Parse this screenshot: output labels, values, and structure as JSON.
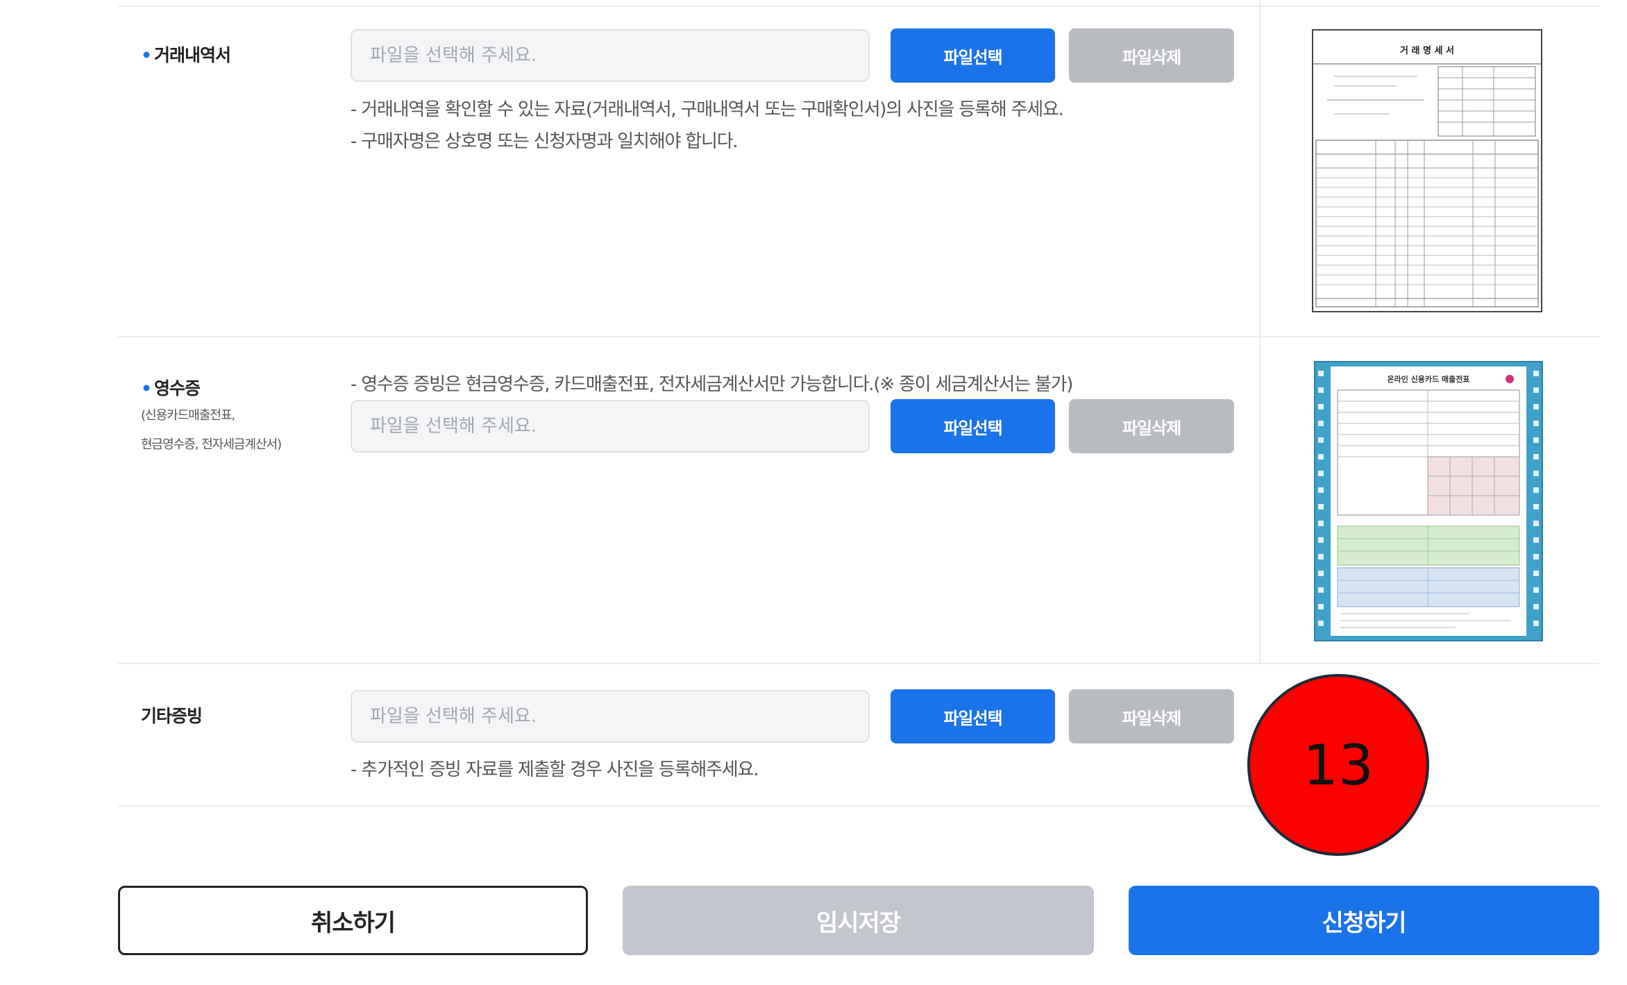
{
  "rows": [
    {
      "label": "거래내역서",
      "required": true,
      "sublabel": [],
      "file_placeholder": "파일을 선택해 주세요.",
      "select_label": "파일선택",
      "delete_label": "파일삭제",
      "notes": [
        "- 거래내역을 확인할 수 있는 자료(거래내역서, 구매내역서 또는 구매확인서)의 사진을 등록해 주세요.",
        "- 구매자명은 상호명 또는 신청자명과 일치해야 합니다."
      ],
      "sample_title": "거 래 명 세 서"
    },
    {
      "label": "영수증",
      "required": true,
      "sublabel": [
        "(신용카드매출전표,",
        "현금영수증, 전자세금계산서)"
      ],
      "file_placeholder": "파일을 선택해 주세요.",
      "select_label": "파일선택",
      "delete_label": "파일삭제",
      "notes": [
        "- 영수증 증빙은 현금영수증, 카드매출전표, 전자세금계산서만 가능합니다.(※ 종이 세금계산서는 불가)"
      ],
      "sample_title": "온라인 신용카드 매출전표"
    },
    {
      "label": "기타증빙",
      "required": false,
      "sublabel": [],
      "file_placeholder": "파일을 선택해 주세요.",
      "select_label": "파일선택",
      "delete_label": "파일삭제",
      "notes": [
        "- 추가적인 증빙 자료를 제출할 경우 사진을 등록해주세요."
      ]
    }
  ],
  "actions": {
    "cancel": "취소하기",
    "temp_save": "임시저장",
    "apply": "신청하기"
  },
  "step_marker": "13",
  "colors": {
    "primary": "#1a73e8",
    "disabled": "#b8bbc0",
    "marker": "#ff0000"
  }
}
